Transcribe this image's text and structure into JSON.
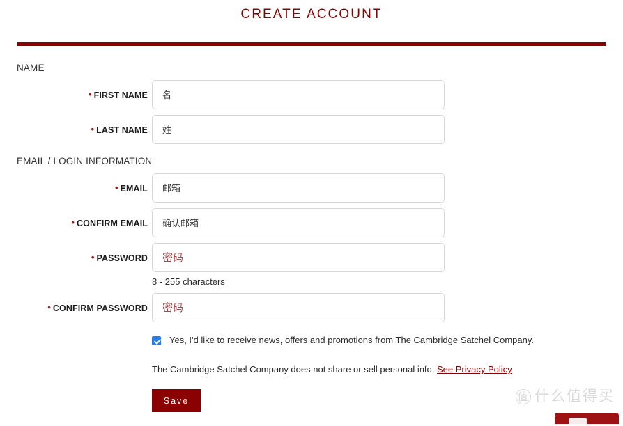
{
  "page": {
    "title": "CREATE ACCOUNT",
    "accent_color": "#8b0000",
    "checkbox_color": "#2680eb"
  },
  "sections": {
    "name": {
      "heading": "NAME",
      "fields": [
        {
          "label": "FIRST NAME",
          "placeholder": "名",
          "value": "",
          "required_marker": "•"
        },
        {
          "label": "LAST NAME",
          "placeholder": "姓",
          "value": "",
          "required_marker": "•"
        }
      ]
    },
    "email": {
      "heading": "EMAIL / LOGIN INFORMATION",
      "fields": [
        {
          "label": "EMAIL",
          "placeholder": "邮箱",
          "value": "",
          "required_marker": "•"
        },
        {
          "label": "CONFIRM EMAIL",
          "placeholder": "确认邮箱",
          "value": "",
          "required_marker": "•"
        },
        {
          "label": "PASSWORD",
          "placeholder": "密码",
          "value": "",
          "required_marker": "•"
        },
        {
          "label": "CONFIRM PASSWORD",
          "placeholder": "密码",
          "value": "",
          "required_marker": "•"
        }
      ],
      "password_helper": "8 - 255 characters"
    }
  },
  "consent": {
    "checked": true,
    "text": "Yes, I'd like to receive news, offers and promotions from The Cambridge Satchel Company."
  },
  "privacy": {
    "text": "The Cambridge Satchel Company does not share or sell personal info.",
    "link_label": "See Privacy Policy"
  },
  "actions": {
    "save_label": "Save"
  },
  "watermark": {
    "badge": "值",
    "text": "什么值得买"
  }
}
